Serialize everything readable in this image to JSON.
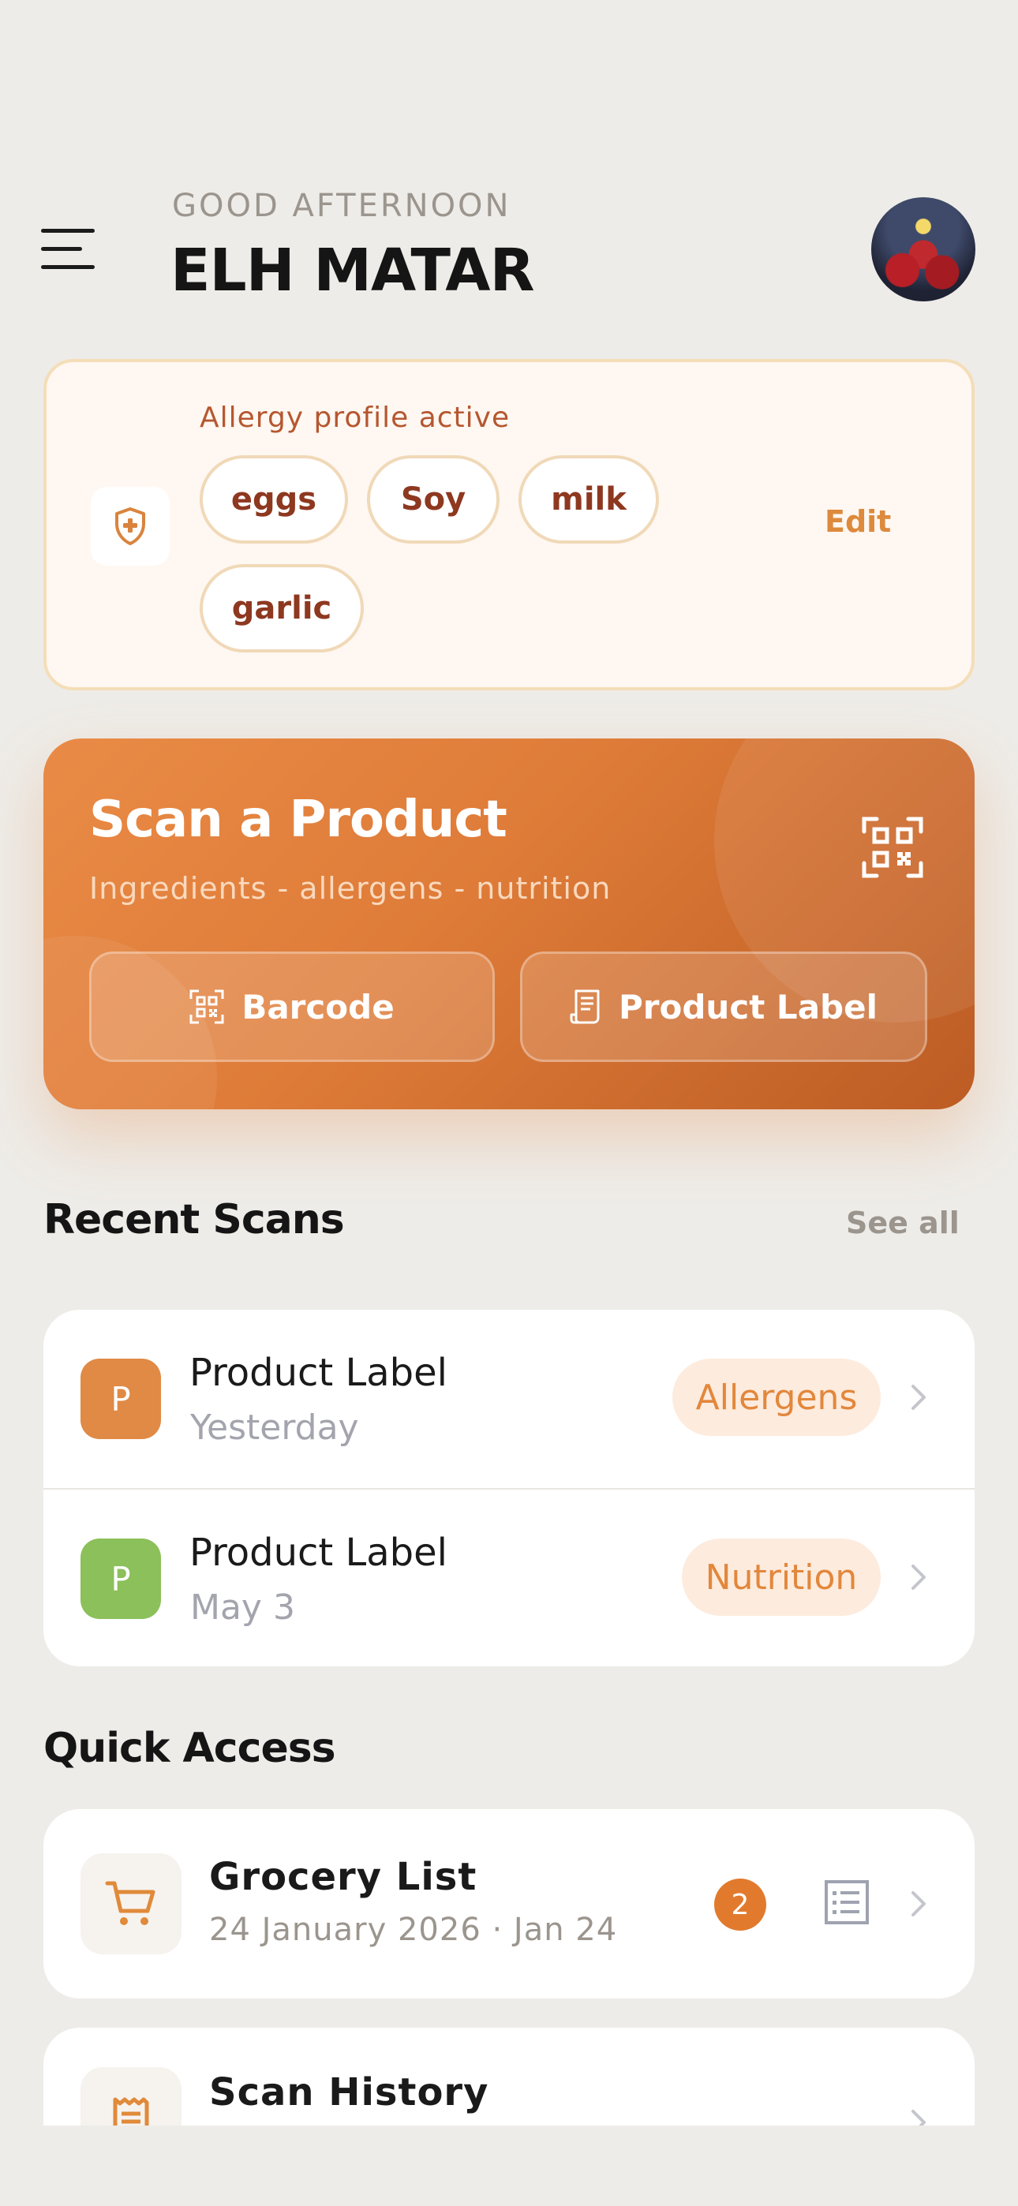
{
  "header": {
    "greeting": "GOOD AFTERNOON",
    "user_name": "ELH MATAR",
    "menu_icon": "hamburger-menu-icon",
    "avatar": "user-avatar"
  },
  "allergy_profile": {
    "title": "Allergy profile active",
    "icon": "shield-plus-icon",
    "allergens": [
      "eggs",
      "Soy",
      "milk",
      "garlic"
    ],
    "edit_label": "Edit"
  },
  "scan": {
    "title": "Scan a Product",
    "subtitle": "Ingredients - allergens - nutrition",
    "icon": "qr-code-icon",
    "barcode_label": "Barcode",
    "product_label_label": "Product Label"
  },
  "recent_scans": {
    "title": "Recent Scans",
    "see_all": "See all",
    "items": [
      {
        "badge": "P",
        "title": "Product Label",
        "date": "Yesterday",
        "tag": "Allergens",
        "badge_color": "#E08A45"
      },
      {
        "badge": "P",
        "title": "Product Label",
        "date": "May 3",
        "tag": "Nutrition",
        "badge_color": "#8CC05A"
      }
    ]
  },
  "quick_access": {
    "title": "Quick Access",
    "items": [
      {
        "title": "Grocery List",
        "subtitle": "24 January 2026 · Jan 24",
        "count": "2",
        "icon": "shopping-cart-icon"
      },
      {
        "title": "Scan History",
        "icon": "receipt-icon"
      }
    ]
  },
  "colors": {
    "background": "#EEECE8",
    "accent": "#E27A2D",
    "allergy_text": "#8E3820",
    "tag_bg": "#FDEBDD"
  }
}
